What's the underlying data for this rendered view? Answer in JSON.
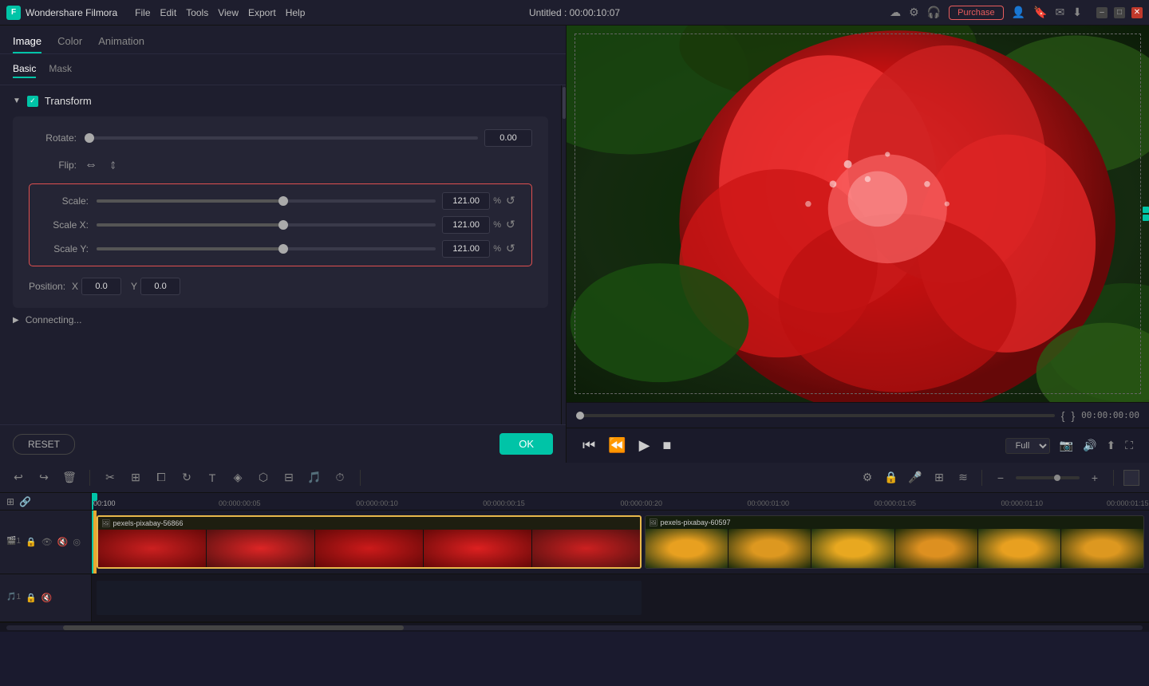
{
  "app": {
    "name": "Wondershare Filmora",
    "logo": "F",
    "title": "Untitled : 00:00:10:07"
  },
  "menu": {
    "items": [
      "File",
      "Edit",
      "Tools",
      "View",
      "Export",
      "Help"
    ]
  },
  "header_icons": {
    "cloud": "☁",
    "settings": "⚙",
    "headphone": "🎧",
    "purchase_label": "Purchase",
    "user": "👤",
    "notifications": "🔔",
    "mail": "✉",
    "download": "⬇"
  },
  "tabs": {
    "items": [
      "Image",
      "Color",
      "Animation"
    ],
    "active": "Image"
  },
  "sub_tabs": {
    "items": [
      "Basic",
      "Mask"
    ],
    "active": "Basic"
  },
  "transform": {
    "title": "Transform",
    "rotate": {
      "label": "Rotate:",
      "value": "0.00"
    },
    "flip": {
      "label": "Flip:"
    },
    "scale": {
      "label": "Scale:",
      "value": "121.00",
      "unit": "%",
      "slider_pct": 55
    },
    "scale_x": {
      "label": "Scale X:",
      "value": "121.00",
      "unit": "%",
      "slider_pct": 55
    },
    "scale_y": {
      "label": "Scale Y:",
      "value": "121.00",
      "unit": "%",
      "slider_pct": 55
    },
    "position": {
      "label": "Position:",
      "x_label": "X",
      "x_value": "0.0",
      "y_label": "Y",
      "y_value": "0.0"
    }
  },
  "connecting": {
    "title": "Connecting..."
  },
  "buttons": {
    "reset": "RESET",
    "ok": "OK"
  },
  "preview": {
    "timecode": "00:00:00:00",
    "quality": "Full"
  },
  "timeline": {
    "ruler_marks": [
      "00:100",
      "00:000:00:05",
      "00:000:00:10",
      "00:000:00:15",
      "00:000:00:20",
      "00:000:01:00",
      "00:000:01:05",
      "00:000:01:10",
      "00:000:01:15"
    ],
    "clips": [
      {
        "name": "pexels-pixabay-56866",
        "start_pct": 0,
        "width_pct": 52,
        "selected": true,
        "color": "#2a2a1a"
      },
      {
        "name": "pexels-pixabay-60597",
        "start_pct": 52.5,
        "width_pct": 47.5,
        "selected": false,
        "color": "#1a2a1a"
      }
    ]
  }
}
